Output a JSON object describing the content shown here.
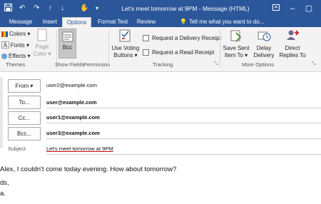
{
  "window": {
    "title": "Let's meet tomorrow at 9PM - Message (HTML)",
    "quick_access": [
      "save-icon",
      "undo-icon",
      "redo-icon",
      "up-icon",
      "down-icon",
      "touch-icon",
      "more-icon"
    ]
  },
  "tabs": [
    {
      "label": "Message",
      "active": false
    },
    {
      "label": "Insert",
      "active": false
    },
    {
      "label": "Options",
      "active": true
    },
    {
      "label": "Format Text",
      "active": false
    },
    {
      "label": "Review",
      "active": false
    }
  ],
  "tell_me": "Tell me what you want to do...",
  "ribbon": {
    "themes": {
      "colors": "Colors",
      "fonts": "Fonts",
      "effects": "Effects",
      "page_color": [
        "Page",
        "Color"
      ],
      "label": "Themes"
    },
    "show_fields": {
      "bcc": "Bcc",
      "label": "Show Fields",
      "permission": "Permission"
    },
    "tracking": {
      "use_voting": [
        "Use Voting",
        "Buttons"
      ],
      "request_delivery": "Request a Delivery Receipt",
      "request_read": "Request a Read Receipt",
      "label": "Tracking"
    },
    "more_options": {
      "save_sent": [
        "Save Sent",
        "Item To"
      ],
      "delay": [
        "Delay",
        "Delivery"
      ],
      "direct": [
        "Direct",
        "Replies To"
      ],
      "label": "More Options"
    }
  },
  "fields": {
    "from": {
      "label": "From",
      "value": "user2@example.com"
    },
    "to": {
      "label": "To...",
      "value": "user@example.com"
    },
    "cc": {
      "label": "Cc...",
      "value": "user1@example.com"
    },
    "bcc": {
      "label": "Bcc...",
      "value": "user3@example.com"
    },
    "subject": {
      "label": "Subject",
      "value": "Let's meet tomorrow at 9PM"
    }
  },
  "body": {
    "line1": "Alex, I couldn't come today evening. How about tomorrow?",
    "line2": "ds,",
    "line3": "a."
  },
  "colors": {
    "title_bar": "#2b579a",
    "ribbon_bg": "#f3f3f3"
  }
}
